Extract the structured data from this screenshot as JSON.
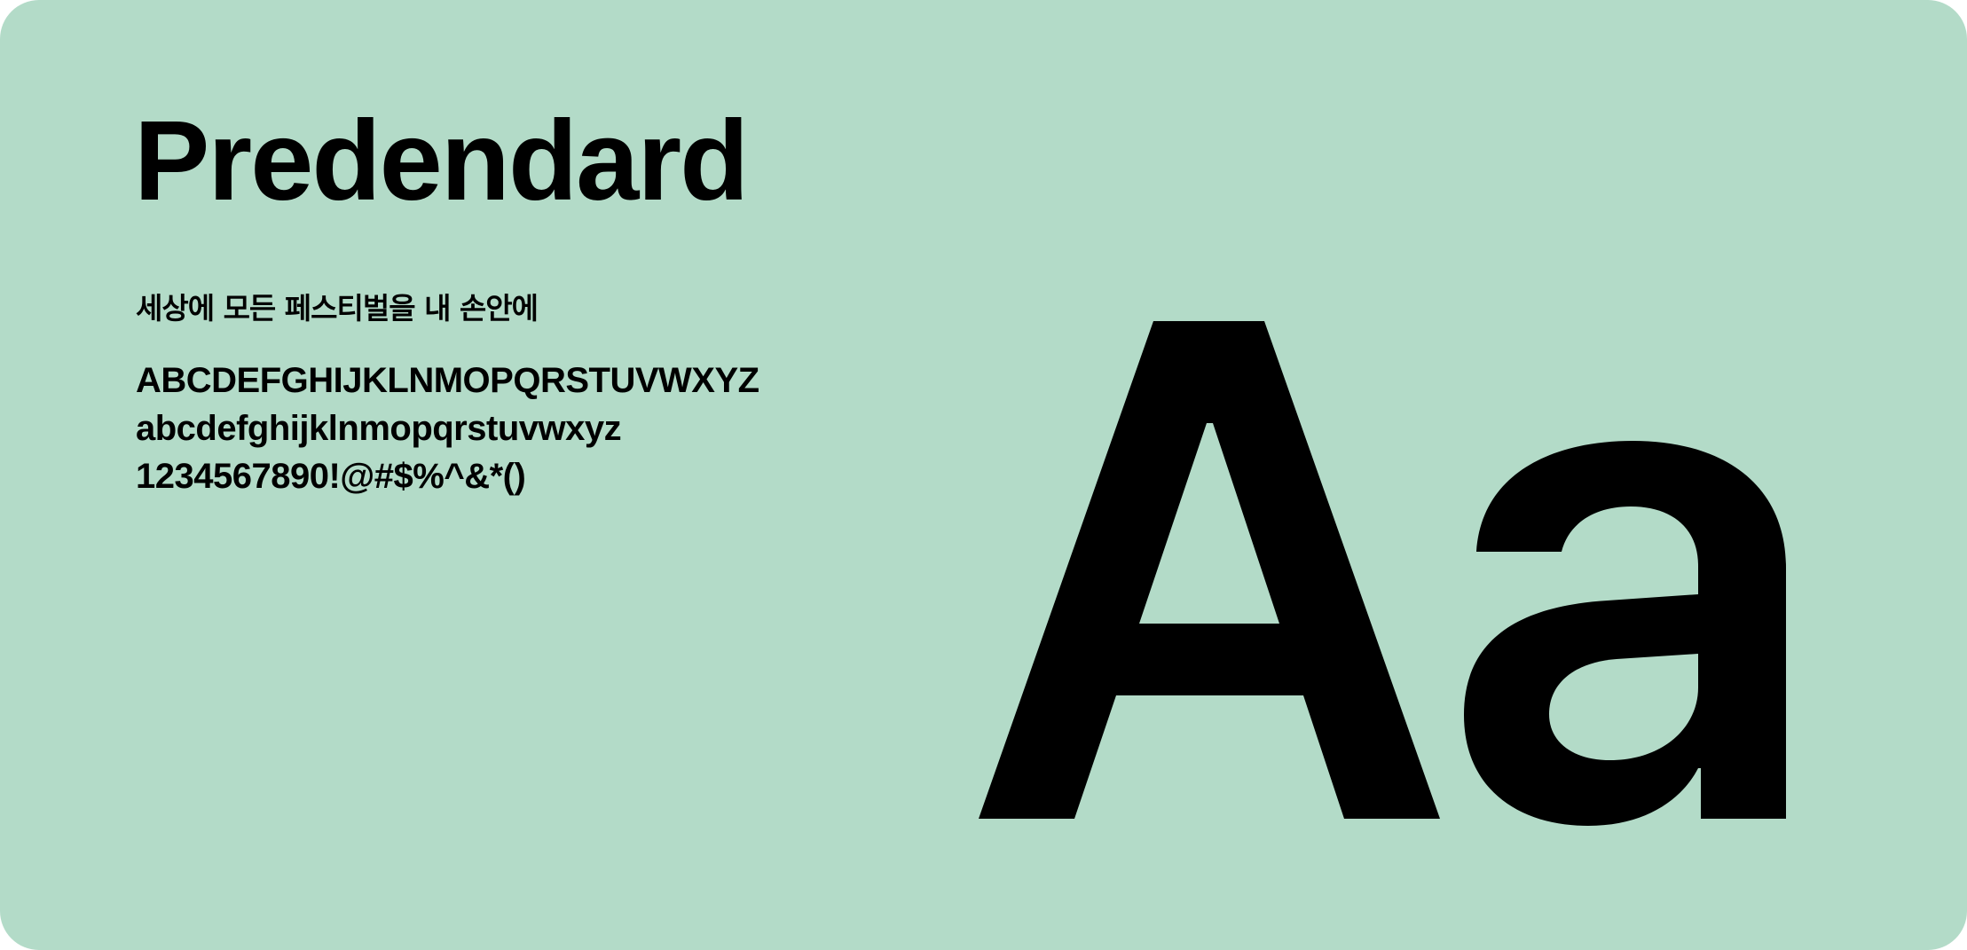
{
  "specimen": {
    "font_name": "Predendard",
    "korean_sample": "세상에 모든 페스티벌을 내 손안에",
    "uppercase": "ABCDEFGHIJKLNMOPQRSTUVWXYZ",
    "lowercase": "abcdefghijklnmopqrstuvwxyz",
    "numbers_symbols": "1234567890!@#$%^&*()",
    "display_glyphs": "Aa"
  },
  "colors": {
    "background": "#b3dbc8",
    "text": "#000000"
  }
}
